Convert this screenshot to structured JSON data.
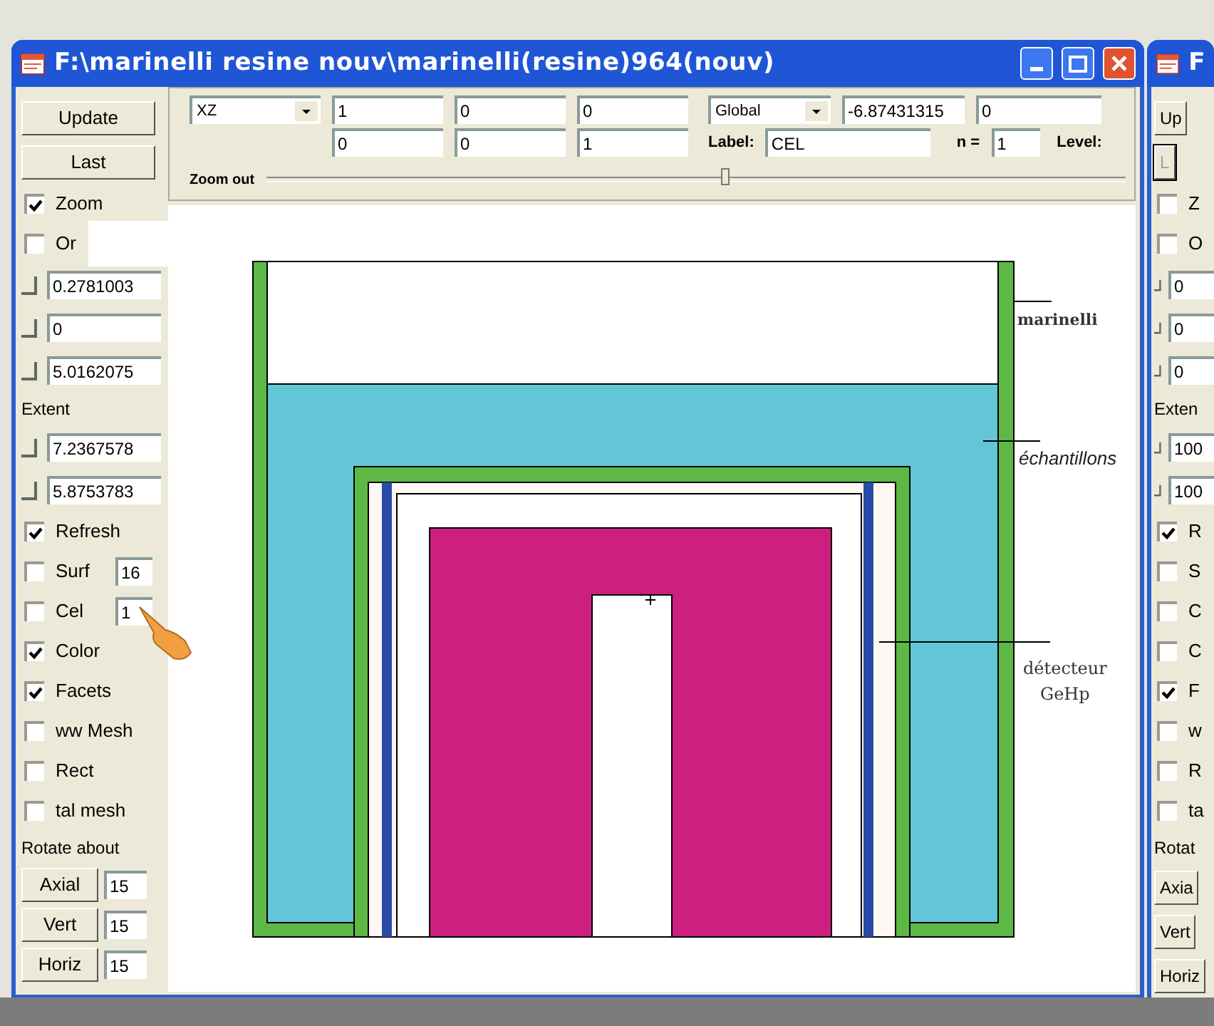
{
  "main_window": {
    "title": "F:\\marinelli resine nouv\\marinelli(resine)964(nouv)",
    "sidebar": [
      {
        "kind": "button",
        "label": "Update",
        "disabled": false
      },
      {
        "kind": "button",
        "label": "Last",
        "disabled": false
      },
      {
        "kind": "check",
        "label": "Zoom",
        "checked": true
      },
      {
        "kind": "check",
        "label": "Or",
        "checked": false
      },
      {
        "kind": "field",
        "value": "0.2781003"
      },
      {
        "kind": "field",
        "value": "0"
      },
      {
        "kind": "field",
        "value": "5.0162075"
      },
      {
        "kind": "heading",
        "label": "Extent"
      },
      {
        "kind": "field",
        "value": "7.2367578"
      },
      {
        "kind": "field",
        "value": "5.8753783"
      },
      {
        "kind": "check",
        "label": "Refresh",
        "checked": true
      },
      {
        "kind": "check_field",
        "label": "Surf",
        "checked": false,
        "value": "16"
      },
      {
        "kind": "check_field",
        "label": "Cel",
        "checked": false,
        "value": "1"
      },
      {
        "kind": "check",
        "label": "Color",
        "checked": true
      },
      {
        "kind": "check",
        "label": "Facets",
        "checked": true
      },
      {
        "kind": "check",
        "label": "ww Mesh",
        "checked": false
      },
      {
        "kind": "check",
        "label": "Rect",
        "checked": false
      },
      {
        "kind": "check",
        "label": "tal mesh",
        "checked": false
      },
      {
        "kind": "heading",
        "label": "Rotate about"
      },
      {
        "kind": "button_field",
        "label": "Axial",
        "value": "15",
        "disabled": false
      },
      {
        "kind": "button_field",
        "label": "Vert",
        "value": "15",
        "disabled": false
      },
      {
        "kind": "button_field",
        "label": "Horiz",
        "value": "15",
        "disabled": false
      }
    ],
    "toolbar": {
      "view_select": "XZ",
      "row1_fields": [
        "1",
        "0",
        "0"
      ],
      "row2_fields": [
        "0",
        "0",
        "1"
      ],
      "frame_select": "Global",
      "coord_fields": [
        "-6.87431315",
        "0"
      ],
      "label_caption": "Label:",
      "label_value": "CEL",
      "n_caption": "n =",
      "n_value": "1",
      "level_caption": "Level:",
      "zoom_caption": "Zoom out",
      "zoom": {
        "level": 0.53
      }
    },
    "plot": {
      "labels": [
        {
          "lines": [
            "marinelli"
          ]
        },
        {
          "lines": [
            "échantillons"
          ]
        },
        {
          "lines": [
            "détecteur",
            "GeHp"
          ]
        }
      ]
    }
  },
  "second_window": {
    "title": "F",
    "sidebar": [
      {
        "kind": "button",
        "label": "Up",
        "disabled": false
      },
      {
        "kind": "button",
        "label": "L",
        "disabled": true
      },
      {
        "kind": "check",
        "label": "Z",
        "checked": false
      },
      {
        "kind": "check",
        "label": "O",
        "checked": false
      },
      {
        "kind": "field",
        "value": "0"
      },
      {
        "kind": "field",
        "value": "0"
      },
      {
        "kind": "field",
        "value": "0"
      },
      {
        "kind": "heading",
        "label": "Exten"
      },
      {
        "kind": "field",
        "value": "100"
      },
      {
        "kind": "field",
        "value": "100"
      },
      {
        "kind": "check",
        "label": "R",
        "checked": true
      },
      {
        "kind": "check",
        "label": "S",
        "checked": false
      },
      {
        "kind": "check",
        "label": "C",
        "checked": false
      },
      {
        "kind": "check",
        "label": "C",
        "checked": false
      },
      {
        "kind": "check",
        "label": "F",
        "checked": true
      },
      {
        "kind": "check",
        "label": "w",
        "checked": false
      },
      {
        "kind": "check",
        "label": "R",
        "checked": false
      },
      {
        "kind": "check",
        "label": "ta",
        "checked": false
      },
      {
        "kind": "heading",
        "label": "Rotat"
      },
      {
        "kind": "button",
        "label": "Axia",
        "disabled": false
      },
      {
        "kind": "button",
        "label": "Vert",
        "disabled": false
      },
      {
        "kind": "button",
        "label": "Horiz",
        "disabled": false
      }
    ]
  }
}
